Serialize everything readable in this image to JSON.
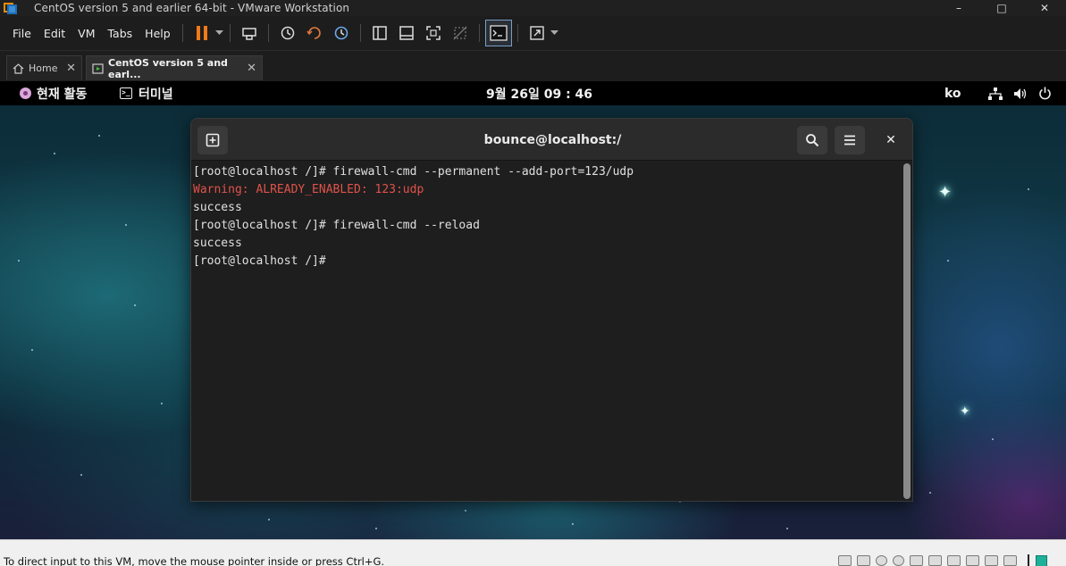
{
  "window": {
    "title": "CentOS version 5 and earlier 64-bit - VMware Workstation",
    "controls": [
      "–",
      "□",
      "✕"
    ]
  },
  "menu": [
    "File",
    "Edit",
    "VM",
    "Tabs",
    "Help"
  ],
  "tabs": {
    "home_label": "Home",
    "vm_label": "CentOS version 5 and earl...",
    "close_glyph": "✕"
  },
  "gnome": {
    "activities": "현재 활동",
    "app_menu": "터미널",
    "clock": "9월 26일  09 : 46",
    "lang": "ko"
  },
  "terminal": {
    "title": "bounce@localhost:/",
    "close_glyph": "✕",
    "lines": [
      {
        "text": "[root@localhost /]# firewall-cmd --permanent --add-port=123/udp",
        "kind": "normal"
      },
      {
        "text": "Warning: ALREADY_ENABLED: 123:udp",
        "kind": "warn"
      },
      {
        "text": "success",
        "kind": "normal"
      },
      {
        "text": "[root@localhost /]# firewall-cmd --reload",
        "kind": "normal"
      },
      {
        "text": "success",
        "kind": "normal"
      },
      {
        "text": "[root@localhost /]# ",
        "kind": "normal"
      }
    ]
  },
  "status": {
    "text": "To direct input to this VM, move the mouse pointer inside or press Ctrl+G."
  },
  "colors": {
    "warning": "#e0524a",
    "pause_accent": "#f07a1a",
    "status_chip": "#1fb09a"
  },
  "icons": {
    "toolbar": [
      "pause-icon",
      "send-ctrl-alt-del-icon",
      "snapshot-icon",
      "revert-snapshot-icon",
      "snapshot-manager-icon",
      "library-view-icon",
      "thumbnail-view-icon",
      "fullscreen-icon",
      "unity-icon",
      "console-view-icon",
      "stretch-view-icon"
    ],
    "tray": [
      "network-icon",
      "volume-icon",
      "power-icon"
    ]
  }
}
